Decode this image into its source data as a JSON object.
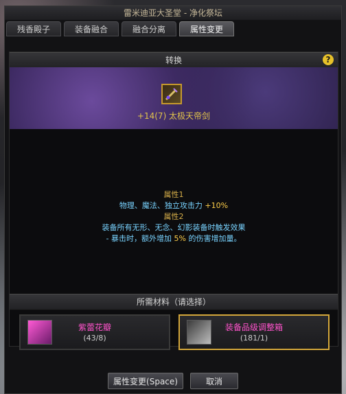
{
  "window": {
    "title": "雷米迪亚大圣堂 - 净化祭坛",
    "tabs": [
      "残香殿子",
      "装备融合",
      "融合分离",
      "属性变更"
    ],
    "active_tab_index": 3
  },
  "section": {
    "header": "转换",
    "help_symbol": "?"
  },
  "item": {
    "name": "+14(7) 太极天帝剑",
    "name_color": "#e2c44a"
  },
  "attributes": {
    "attr1_title": "属性1",
    "attr1_text_prefix": "物理、魔法、独立攻击力 ",
    "attr1_value": "+10%",
    "attr2_title": "属性2",
    "attr2_line1": "装备所有无形、无念、幻影装备时触发效果",
    "attr2_line2_prefix": "- 暴击时，额外增加",
    "attr2_line2_value": "5%",
    "attr2_line2_suffix": "的伤害增加量。"
  },
  "materials": {
    "header": "所需材料（请选择）",
    "items": [
      {
        "name": "紫蕾花瓣",
        "count": "(43/8)",
        "selected": false,
        "icon": "petal-icon"
      },
      {
        "name": "装备品级调整箱",
        "count": "(181/1)",
        "selected": true,
        "icon": "box-icon"
      }
    ]
  },
  "buttons": {
    "confirm_label": "属性变更(Space)",
    "cancel_label": "取消"
  },
  "colors": {
    "accent_gold": "#d4a73a",
    "material_name": "#ff53cc",
    "attribute_text": "#79d3ff"
  }
}
